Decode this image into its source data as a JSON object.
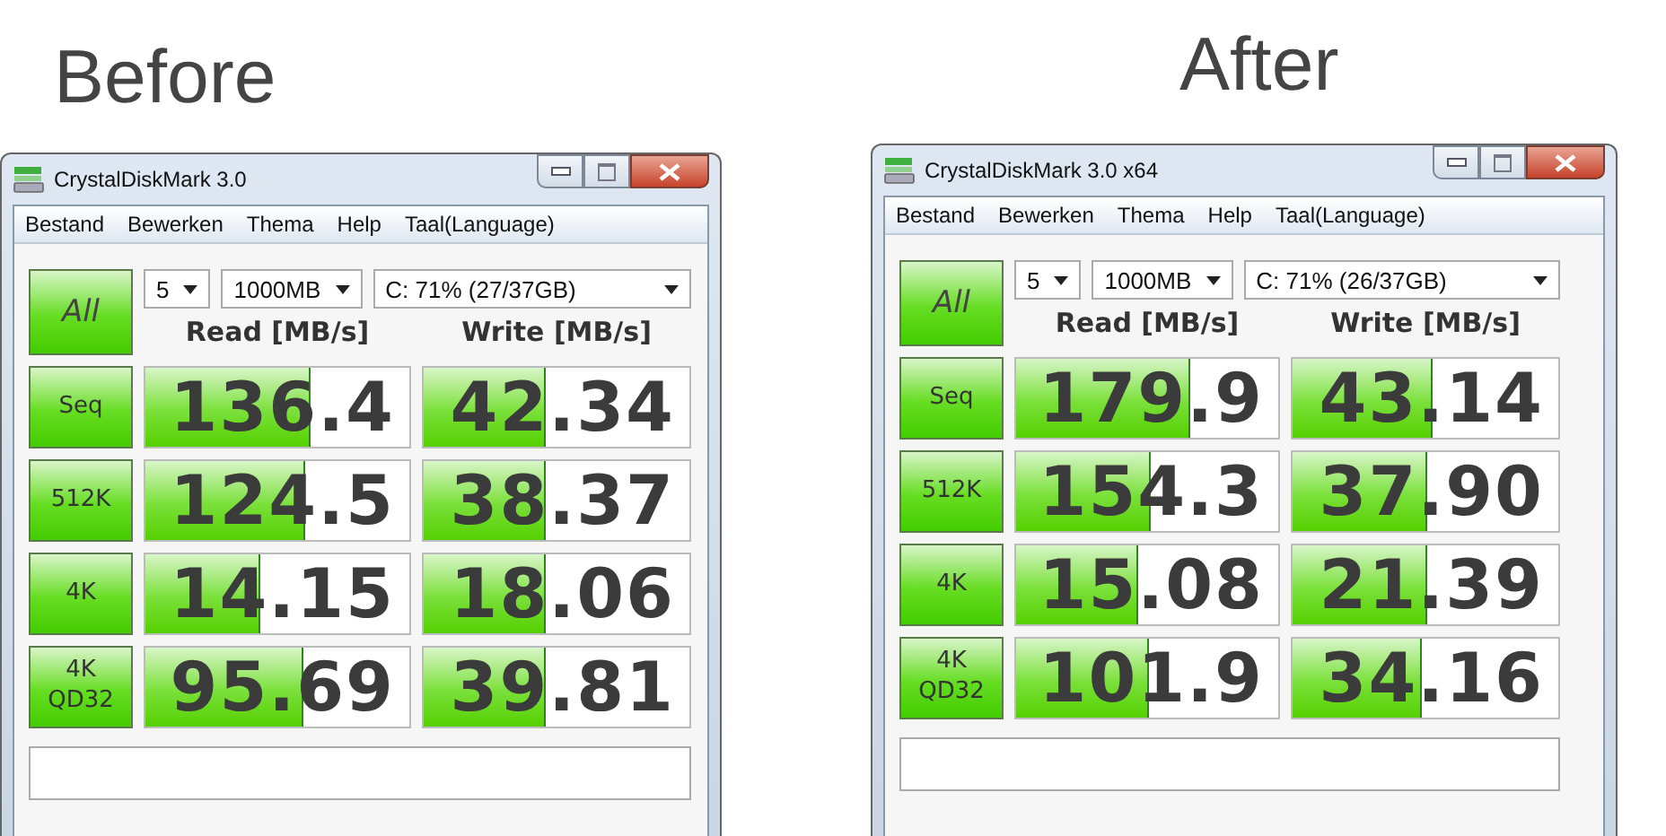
{
  "panels": [
    {
      "heading": "Before",
      "window": {
        "title": "CrystalDiskMark 3.0",
        "menu": [
          "Bestand",
          "Bewerken",
          "Thema",
          "Help",
          "Taal(Language)"
        ],
        "all_button": "All",
        "selects": [
          "5",
          "1000MB",
          "C: 71% (27/37GB)"
        ],
        "columns": [
          "Read [MB/s]",
          "Write [MB/s]"
        ],
        "rows": [
          {
            "label": "Seq",
            "read": {
              "value": "136.4",
              "level": 0.62
            },
            "write": {
              "value": "42.34",
              "level": 0.45
            }
          },
          {
            "label": "512K",
            "read": {
              "value": "124.5",
              "level": 0.6
            },
            "write": {
              "value": "38.37",
              "level": 0.45
            }
          },
          {
            "label": "4K",
            "read": {
              "value": "14.15",
              "level": 0.43
            },
            "write": {
              "value": "18.06",
              "level": 0.45
            }
          },
          {
            "label": "4K\nQD32",
            "read": {
              "value": "95.69",
              "level": 0.59
            },
            "write": {
              "value": "39.81",
              "level": 0.45
            }
          }
        ]
      }
    },
    {
      "heading": "After",
      "window": {
        "title": "CrystalDiskMark 3.0 x64",
        "menu": [
          "Bestand",
          "Bewerken",
          "Thema",
          "Help",
          "Taal(Language)"
        ],
        "all_button": "All",
        "selects": [
          "5",
          "1000MB",
          "C: 71% (26/37GB)"
        ],
        "columns": [
          "Read [MB/s]",
          "Write [MB/s]"
        ],
        "rows": [
          {
            "label": "Seq",
            "read": {
              "value": "179.9",
              "level": 0.66
            },
            "write": {
              "value": "43.14",
              "level": 0.52
            }
          },
          {
            "label": "512K",
            "read": {
              "value": "154.3",
              "level": 0.51
            },
            "write": {
              "value": "37.90",
              "level": 0.5
            }
          },
          {
            "label": "4K",
            "read": {
              "value": "15.08",
              "level": 0.46
            },
            "write": {
              "value": "21.39",
              "level": 0.5
            }
          },
          {
            "label": "4K\nQD32",
            "read": {
              "value": "101.9",
              "level": 0.5
            },
            "write": {
              "value": "34.16",
              "level": 0.48
            }
          }
        ]
      }
    }
  ]
}
